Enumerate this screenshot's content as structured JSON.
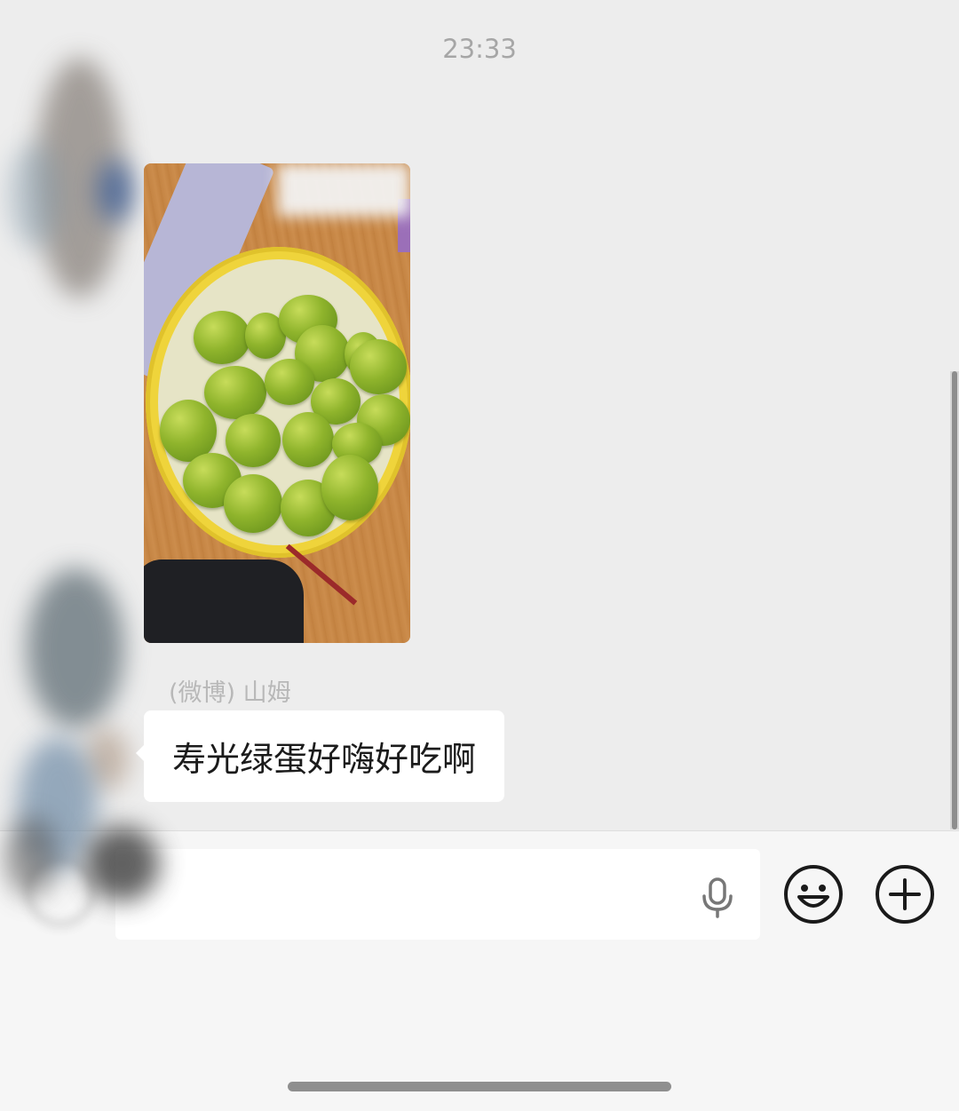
{
  "chat": {
    "timestamp": "23:33",
    "messages": [
      {
        "type": "image",
        "sender_name": "",
        "image_description": "photo"
      },
      {
        "type": "text",
        "sender_name": "(微博) 山姆",
        "text": "寿光绿蛋好嗨好吃啊"
      }
    ]
  },
  "input_bar": {
    "placeholder": "",
    "icons": [
      "voice-icon",
      "microphone-icon",
      "emoji-icon",
      "plus-icon"
    ]
  },
  "colors": {
    "chat_background": "#ededed",
    "bubble_background": "#ffffff",
    "input_bar_background": "#f6f6f6",
    "icon_color": "#1a1a1a"
  }
}
